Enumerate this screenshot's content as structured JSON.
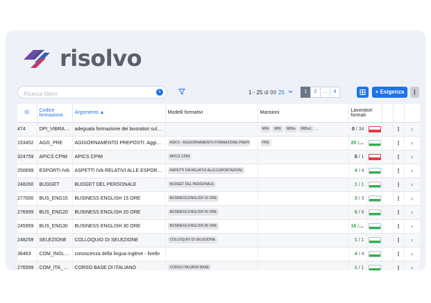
{
  "brand": {
    "name": "risolvo"
  },
  "search": {
    "placeholder": "Ricerca libero",
    "info_icon": "info-icon"
  },
  "pagination": {
    "range_text": "1 - 25",
    "of_text": "di 99",
    "page_size": "25",
    "pages": [
      "1",
      "2",
      "...",
      "4"
    ],
    "active_page": "1"
  },
  "toolbar": {
    "new_label": "+ Esigenza",
    "more_label": "⋮"
  },
  "colors": {
    "accent": "#1f73e8",
    "ok_green": "#28a745",
    "warn_red": "#e53944",
    "panel_bg": "#eef1f7"
  },
  "table": {
    "headers": {
      "id": "ID",
      "code": "Codice formazione",
      "topic": "Argomento ▲",
      "models": "Modelli formativi",
      "duties": "Mansioni",
      "workers": "Lavoratori formati"
    },
    "rows": [
      {
        "id": "474",
        "code": "DPI_VIBRAZIONI",
        "topic": "adeguata formazione dei lavoratori sull'uso DPI",
        "models": [],
        "duties": [
          "M04",
          "M06",
          "M06a",
          "M06a1"
        ],
        "more_duties": "...",
        "done": "0",
        "total": "34",
        "status": "red"
      },
      {
        "id": "153452",
        "code": "AGG_PRE",
        "topic": "AGGIORNAMENTO PREPOSTI: Aggiornamento",
        "models": [
          "ASR.5 - AGGIORNAMENTO FORMAZIONE PREPOSTI"
        ],
        "duties": [
          "PRE"
        ],
        "more_duties": "",
        "done": "20",
        "total": "25",
        "status": "green"
      },
      {
        "id": "324759",
        "code": "APICS CPIM",
        "topic": "APICS CPIM",
        "models": [
          "APICS CPIM"
        ],
        "duties": [],
        "more_duties": "",
        "done": "0",
        "total": "1",
        "status": "red"
      },
      {
        "id": "250699",
        "code": "ESPORTI-IVA",
        "topic": "ASPETTI IVA RELATIVI ALLE ESPORTAZIONI",
        "models": [
          "ASPETTI IVA RELATIVI ALLE ESPORTAZIONI"
        ],
        "duties": [],
        "more_duties": "",
        "done": "4",
        "total": "4",
        "status": "green"
      },
      {
        "id": "248260",
        "code": "BUDGET",
        "topic": "BUDGET DEL PERSONALE",
        "models": [
          "BUDGET DEL PERSONALE"
        ],
        "duties": [],
        "more_duties": "",
        "done": "1",
        "total": "1",
        "status": "green"
      },
      {
        "id": "277000",
        "code": "BUS_ENG15",
        "topic": "BUSINESS ENGLISH 15 ORE",
        "models": [
          "BUSINESS ENGLISH 15 ORE"
        ],
        "duties": [],
        "more_duties": "",
        "done": "3",
        "total": "3",
        "status": "green"
      },
      {
        "id": "276999",
        "code": "BUS_ENG20",
        "topic": "BUSINESS ENGLISH 20 ORE",
        "models": [
          "BUSINESS ENGLISH 20 ORE"
        ],
        "duties": [],
        "more_duties": "",
        "done": "6",
        "total": "6",
        "status": "green"
      },
      {
        "id": "245959",
        "code": "BUS_ENG30",
        "topic": "BUSINESS ENGLISH 30 ORE",
        "models": [
          "BUSINESS ENGLISH 30 ORE"
        ],
        "duties": [],
        "more_duties": "",
        "done": "16",
        "total": "16",
        "status": "green"
      },
      {
        "id": "248259",
        "code": "SELEZIONE",
        "topic": "COLLOQUIO DI SELEZIONE",
        "models": [
          "COLLOQUIO DI SELEZIONE"
        ],
        "duties": [],
        "more_duties": "",
        "done": "1",
        "total": "1",
        "status": "green"
      },
      {
        "id": "36463",
        "code": "COM_INGLESE",
        "topic": "conoscenza della lingua inglese - livello",
        "models": [],
        "duties": [],
        "more_duties": "",
        "done": "4",
        "total": "4",
        "status": "green"
      },
      {
        "id": "276599",
        "code": "COM_ITA_BASE",
        "topic": "CORSO BASE DI ITALIANO",
        "models": [
          "CORSO ITALIANO BASE"
        ],
        "duties": [],
        "more_duties": "",
        "done": "1",
        "total": "1",
        "status": "green"
      },
      {
        "id": "",
        "code": "",
        "topic": "",
        "models": [],
        "duties": [],
        "more_duties": "",
        "done": "",
        "total": "",
        "status": ""
      }
    ]
  }
}
